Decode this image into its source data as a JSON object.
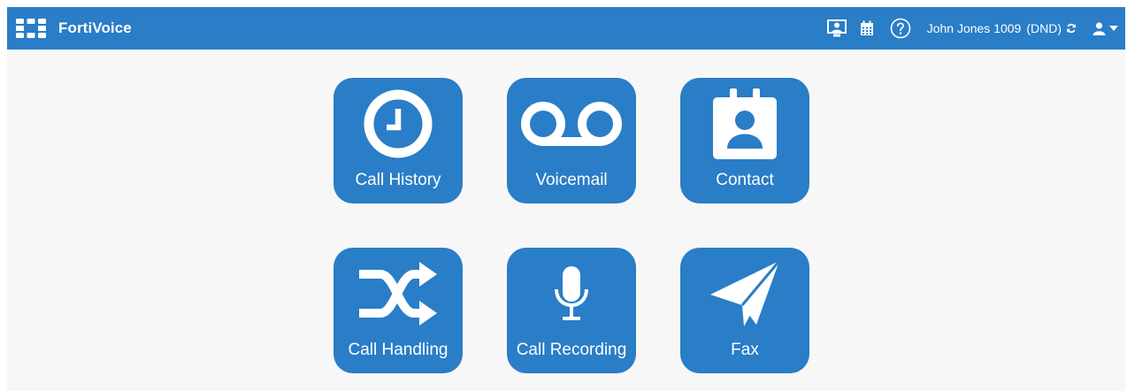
{
  "header": {
    "brand": "FortiVoice",
    "user_name": "John Jones 1009",
    "user_status": "(DND)",
    "icons": {
      "logo": "fortinet-logo-icon",
      "presence": "presence-icon",
      "calendar": "calendar-icon",
      "help": "help-circle-icon",
      "refresh": "refresh-icon",
      "user": "user-icon",
      "dropdown": "caret-down-icon"
    }
  },
  "tiles": [
    {
      "label": "Call History",
      "icon": "clock-icon"
    },
    {
      "label": "Voicemail",
      "icon": "voicemail-icon"
    },
    {
      "label": "Contact",
      "icon": "contact-card-icon"
    },
    {
      "label": "Call Handling",
      "icon": "shuffle-icon"
    },
    {
      "label": "Call Recording",
      "icon": "microphone-icon"
    },
    {
      "label": "Fax",
      "icon": "paper-plane-icon"
    }
  ],
  "colors": {
    "accent": "#2a7dc7",
    "background": "#f7f7f7",
    "text_on_accent": "#ffffff"
  }
}
